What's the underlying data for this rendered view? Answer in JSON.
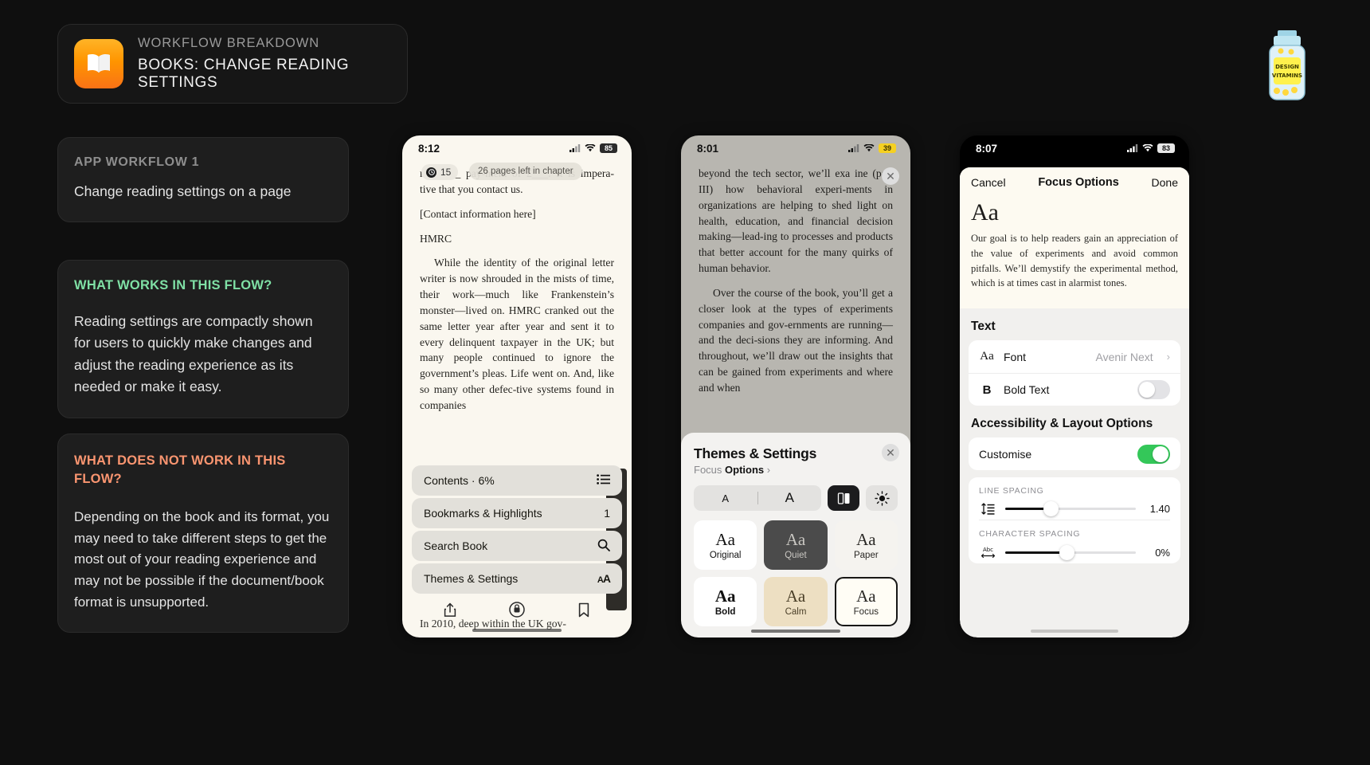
{
  "header": {
    "kicker": "WORKFLOW BREAKDOWN",
    "title": "BOOKS: CHANGE READING SETTINGS",
    "icon": "books-app-icon"
  },
  "branding": {
    "bottle_line1": "DESIGN",
    "bottle_line2": "VITAMINS"
  },
  "colors": {
    "background": "#0f0f0f",
    "card": "#1e1e1e",
    "accent_green": "#7fe0a5",
    "accent_orange": "#fa9570",
    "app_icon_orange": "#ff9500",
    "toggle_on": "#34c759",
    "battery_yellow": "#f5d021"
  },
  "cards": [
    {
      "kicker": "APP WORKFLOW 1",
      "body": "Change reading settings on a page"
    },
    {
      "title": "WHAT WORKS IN THIS FLOW?",
      "body": "Reading settings are compactly shown for users to quickly make changes and adjust the reading experience as its needed or make it easy."
    },
    {
      "title": "WHAT DOES NOT WORK IN THIS FLOW?",
      "body": "Depending on the book and its format, you may need to take different steps to get the most out of your reading experience and may not be possible if the document/book format is unsupported."
    }
  ],
  "phone1": {
    "status": {
      "time": "8:12",
      "battery": "85"
    },
    "page_badge": "15",
    "tooltip": "26 pages left in chapter",
    "page_text": [
      "re______ pay-ment of £___. It is impera-tive that you contact us.",
      "[Contact          information here]",
      "HMRC",
      "While the identity of the original letter writer is now shrouded in the mists of time, their work—much like Frankenstein’s monster—lived on. HMRC cranked out the same letter year after year and sent it to every delinquent taxpayer in the UK; but many people continued to ignore the government’s pleas. Life went on. And, like so many other defec-tive systems found in companies"
    ],
    "page_text_tail": "In 2010, deep within the UK gov-",
    "menu": [
      {
        "label": "Contents · 6%",
        "value": "",
        "icon": "list-icon"
      },
      {
        "label": "Bookmarks & Highlights",
        "value": "1",
        "icon": ""
      },
      {
        "label": "Search Book",
        "value": "",
        "icon": "search-icon"
      },
      {
        "label": "Themes & Settings",
        "value": "",
        "icon": "aa-icon"
      }
    ],
    "toolbar": [
      "share-icon",
      "rotation-lock-icon",
      "bookmark-icon"
    ]
  },
  "phone2": {
    "status": {
      "time": "8:01",
      "battery": "39"
    },
    "page_text": [
      "beyond the tech sector, we’ll exa ine (part III) how behavioral experi-ments in organizations are helping to shed light on health, education, and financial decision making—lead-ing to processes and products that better account for the many quirks of human behavior.",
      "Over the course of the book, you’ll get a closer look at the types of experiments companies and gov-ernments are running—and the deci-sions they are informing. And throughout, we’ll draw out the insights that can be gained from experiments and where and when"
    ],
    "sheet": {
      "title": "Themes & Settings",
      "sub_prefix": "Focus",
      "sub_link": "Options",
      "close": "close-icon",
      "segment": {
        "small_a": "A",
        "large_a": "A"
      },
      "page_view_icon": "page-layout-icon",
      "brightness_icon": "brightness-icon",
      "themes": [
        {
          "sample": "Aa",
          "name": "Original",
          "selected": false
        },
        {
          "sample": "Aa",
          "name": "Quiet",
          "selected": false
        },
        {
          "sample": "Aa",
          "name": "Paper",
          "selected": false
        },
        {
          "sample": "Aa",
          "name": "Bold",
          "selected": false
        },
        {
          "sample": "Aa",
          "name": "Calm",
          "selected": false
        },
        {
          "sample": "Aa",
          "name": "Focus",
          "selected": true
        }
      ]
    }
  },
  "phone3": {
    "status": {
      "time": "8:07",
      "battery": "83"
    },
    "nav": {
      "cancel": "Cancel",
      "title": "Focus Options",
      "done": "Done"
    },
    "preview": {
      "sample": "Aa",
      "body": "Our goal is to help readers gain an appreciation of the value of experiments and avoid common pitfalls. We’ll demystify the experimental method, which is at times cast in alarmist tones."
    },
    "text_section": {
      "heading": "Text",
      "rows": [
        {
          "icon": "aa-icon",
          "label": "Font",
          "value": "Avenir Next",
          "type": "chevron"
        },
        {
          "icon": "bold-b-icon",
          "label": "Bold Text",
          "value": "",
          "type": "toggle",
          "on": false
        }
      ]
    },
    "accessibility_section": {
      "heading": "Accessibility & Layout Options",
      "customise": {
        "label": "Customise",
        "on": true
      },
      "sliders": [
        {
          "label": "LINE SPACING",
          "icon": "line-spacing-icon",
          "value": "1.40",
          "percent": 35
        },
        {
          "label": "CHARACTER SPACING",
          "icon": "character-spacing-icon",
          "value": "0%",
          "percent": 47
        }
      ]
    }
  }
}
